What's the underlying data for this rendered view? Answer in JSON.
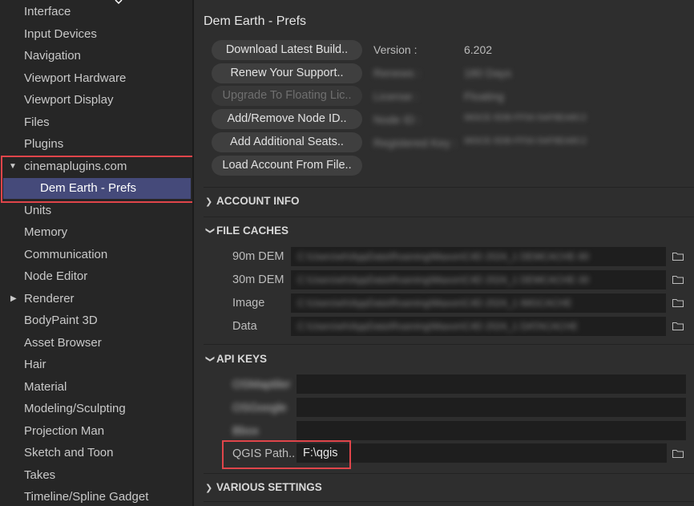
{
  "sidebar": {
    "items": [
      {
        "label": "Interface"
      },
      {
        "label": "Input Devices"
      },
      {
        "label": "Navigation"
      },
      {
        "label": "Viewport Hardware"
      },
      {
        "label": "Viewport Display"
      },
      {
        "label": "Files"
      },
      {
        "label": "Plugins"
      },
      {
        "label": "cinemaplugins.com"
      },
      {
        "label": "Dem Earth - Prefs"
      },
      {
        "label": "Units"
      },
      {
        "label": "Memory"
      },
      {
        "label": "Communication"
      },
      {
        "label": "Node Editor"
      },
      {
        "label": "Renderer"
      },
      {
        "label": "BodyPaint 3D"
      },
      {
        "label": "Asset Browser"
      },
      {
        "label": "Hair"
      },
      {
        "label": "Material"
      },
      {
        "label": "Modeling/Sculpting"
      },
      {
        "label": "Projection Man"
      },
      {
        "label": "Sketch and Toon"
      },
      {
        "label": "Takes"
      },
      {
        "label": "Timeline/Spline Gadget"
      }
    ]
  },
  "main": {
    "title": "Dem Earth - Prefs",
    "buttons": {
      "download": "Download Latest Build..",
      "renew": "Renew Your Support..",
      "upgrade": "Upgrade To Floating Lic..",
      "add_remove": "Add/Remove Node ID..",
      "add_seats": "Add Additional Seats..",
      "load_account": "Load Account From File.."
    },
    "info": {
      "version_label": "Version :",
      "version_value": "6.202",
      "blurred_rows": [
        {
          "label": "Renews :",
          "value": "180 Days"
        },
        {
          "label": "License :",
          "value": "Floating"
        },
        {
          "label": "Node ID :",
          "value": "983CE-5DB-FF00-5AF8EA8C2"
        },
        {
          "label": "Registered Key :",
          "value": "983CE-5DB-FF00-5AF8EA8C2"
        }
      ]
    },
    "sections": {
      "account_info": "ACCOUNT INFO",
      "file_caches": "FILE CACHES",
      "api_keys": "API KEYS",
      "various_settings": "VARIOUS SETTINGS"
    },
    "file_caches": {
      "rows": [
        {
          "label": "90m DEM",
          "value": "C:\\Users\\eh\\AppData\\Roaming\\Maxon\\C4D 2024_1 DEMCACHE-90"
        },
        {
          "label": "30m DEM",
          "value": "C:\\Users\\eh\\AppData\\Roaming\\Maxon\\C4D 2024_1 DEMCACHE-30"
        },
        {
          "label": "Image",
          "value": "C:\\Users\\eh\\AppData\\Roaming\\Maxon\\C4D 2024_1 IMGCACHE"
        },
        {
          "label": "Data",
          "value": "C:\\Users\\eh\\AppData\\Roaming\\Maxon\\C4D 2024_1 DATACACHE"
        }
      ]
    },
    "api_keys": {
      "blurred_rows": [
        {
          "label": "OSMaptiler"
        },
        {
          "label": "OSGoogle"
        },
        {
          "label": "Bbox"
        }
      ],
      "qgis_label": "QGIS Path..",
      "qgis_value": "F:\\qgis"
    }
  }
}
